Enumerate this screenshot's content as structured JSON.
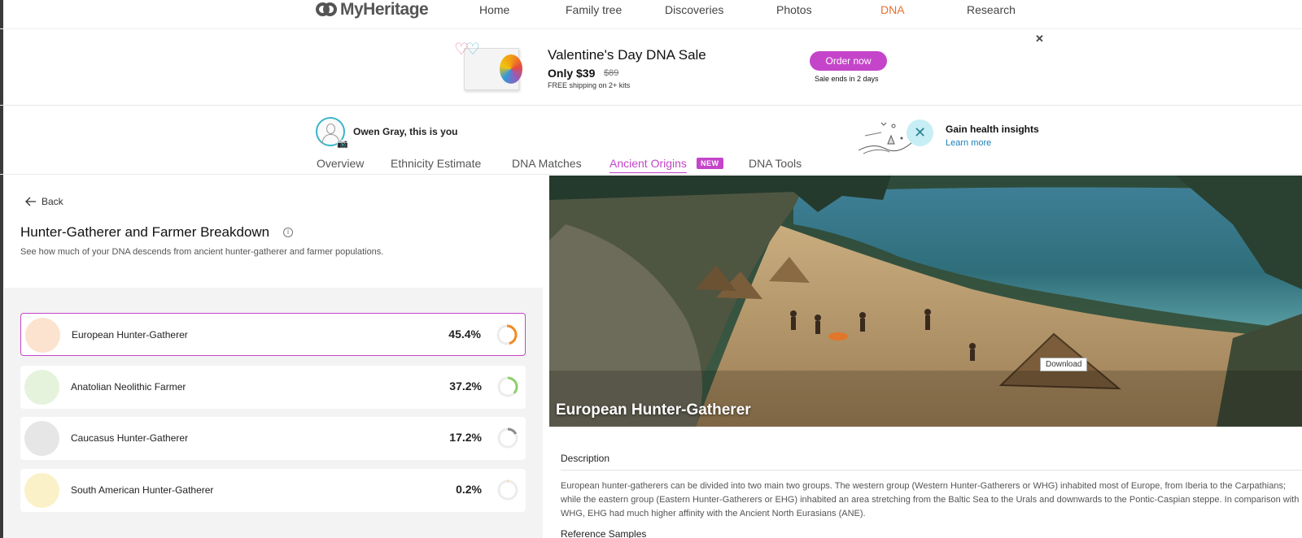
{
  "brand": {
    "name": "MyHeritage"
  },
  "nav": {
    "items": [
      "Home",
      "Family tree",
      "Discoveries",
      "Photos",
      "DNA",
      "Research"
    ],
    "active": "DNA",
    "active_color": "#e8702a"
  },
  "promo": {
    "title": "Valentine's Day DNA Sale",
    "price": "Only $39",
    "old_price": "$89",
    "shipping": "FREE shipping on 2+ kits",
    "order_label": "Order now",
    "sale_ends": "Sale ends in 2 days",
    "close_symbol": "✕",
    "button_color": "#c445c9"
  },
  "profile": {
    "you_text": "Owen Gray, this is you"
  },
  "health": {
    "title": "Gain health insights",
    "link": "Learn more"
  },
  "tabs": {
    "items": [
      "Overview",
      "Ethnicity Estimate",
      "DNA Matches",
      "Ancient Origins",
      "DNA Tools"
    ],
    "active": "Ancient Origins",
    "new_badge": "NEW"
  },
  "breakdown": {
    "back_label": "Back",
    "title": "Hunter-Gatherer and Farmer Breakdown",
    "info_symbol": "i",
    "subtitle": "See how much of your DNA descends from ancient hunter-gatherer and farmer populations.",
    "items": [
      {
        "name": "European Hunter-Gatherer",
        "percent_label": "45.4%",
        "value": 45.4,
        "color": "#f08a24",
        "thumb_color": "#fbe3cf",
        "selected": true
      },
      {
        "name": "Anatolian Neolithic Farmer",
        "percent_label": "37.2%",
        "value": 37.2,
        "color": "#8ccf6a",
        "thumb_color": "#e6f3dc",
        "selected": false
      },
      {
        "name": "Caucasus Hunter-Gatherer",
        "percent_label": "17.2%",
        "value": 17.2,
        "color": "#8a8a8a",
        "thumb_color": "#e6e6e6",
        "selected": false
      },
      {
        "name": "South American Hunter-Gatherer",
        "percent_label": "0.2%",
        "value": 0.2,
        "color": "#e9c84a",
        "thumb_color": "#fbf1c9",
        "selected": false
      }
    ]
  },
  "detail": {
    "hero_title": "European Hunter-Gatherer",
    "download_label": "Download",
    "description_label": "Description",
    "description": "European hunter-gatherers can be divided into two main two groups. The western group (Western Hunter-Gatherers or WHG) inhabited most of Europe, from Iberia to the Carpathians; while the eastern group (Eastern Hunter-Gatherers or EHG) inhabited an area stretching from the Baltic Sea to the Urals and downwards to the Pontic-Caspian steppe. In comparison with WHG, EHG had much higher affinity with the Ancient North Eurasians (ANE).",
    "reference_label": "Reference Samples"
  }
}
